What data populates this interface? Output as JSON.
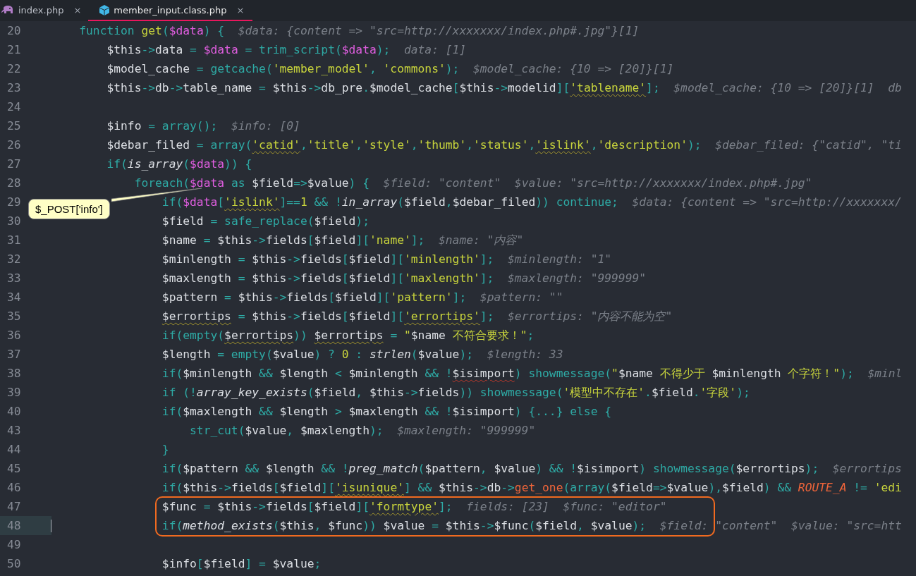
{
  "tabs": [
    {
      "label": "index.php",
      "selected": false,
      "close": "×"
    },
    {
      "label": "member_input.class.php",
      "selected": true,
      "close": "×"
    }
  ],
  "callout": {
    "text": "$_POST['info']"
  },
  "lines": [
    {
      "number": "20",
      "current": false,
      "boxed": false,
      "tokens": [
        {
          "kind": "k",
          "text": "    function "
        },
        {
          "kind": "s",
          "text": "get"
        },
        {
          "kind": "k",
          "text": "("
        },
        {
          "kind": "v",
          "text": "$data"
        },
        {
          "kind": "k",
          "text": ") {"
        }
      ],
      "hint": "$data: {content => \"src=http://xxxxxxx/index.php#.jpg\"}[1]"
    },
    {
      "number": "21",
      "current": false,
      "boxed": false,
      "tokens": [
        {
          "kind": "t",
          "text": "        $this"
        },
        {
          "kind": "k",
          "text": "->"
        },
        {
          "kind": "t",
          "text": "data "
        },
        {
          "kind": "k",
          "text": "= "
        },
        {
          "kind": "v",
          "text": "$data"
        },
        {
          "kind": "k",
          "text": " = trim_script("
        },
        {
          "kind": "v",
          "text": "$data"
        },
        {
          "kind": "k",
          "text": ");"
        }
      ],
      "hint": "data: [1]"
    },
    {
      "number": "22",
      "current": false,
      "boxed": false,
      "tokens": [
        {
          "kind": "t",
          "text": "        $model_cache "
        },
        {
          "kind": "k",
          "text": "= getcache("
        },
        {
          "kind": "s",
          "text": "'member_model'"
        },
        {
          "kind": "k",
          "text": ", "
        },
        {
          "kind": "s",
          "text": "'commons'"
        },
        {
          "kind": "k",
          "text": ");"
        }
      ],
      "hint": "$model_cache: {10 => [20]}[1]"
    },
    {
      "number": "23",
      "current": false,
      "boxed": false,
      "tokens": [
        {
          "kind": "t",
          "text": "        $this"
        },
        {
          "kind": "k",
          "text": "->"
        },
        {
          "kind": "t",
          "text": "db"
        },
        {
          "kind": "k",
          "text": "->"
        },
        {
          "kind": "t",
          "text": "table_name "
        },
        {
          "kind": "k",
          "text": "= "
        },
        {
          "kind": "t",
          "text": "$this"
        },
        {
          "kind": "k",
          "text": "->"
        },
        {
          "kind": "t",
          "text": "db_pre"
        },
        {
          "kind": "k",
          "text": "."
        },
        {
          "kind": "t",
          "text": "$model_cache"
        },
        {
          "kind": "k",
          "text": "["
        },
        {
          "kind": "t",
          "text": "$this"
        },
        {
          "kind": "k",
          "text": "->"
        },
        {
          "kind": "t",
          "text": "modelid"
        },
        {
          "kind": "k",
          "text": "]["
        },
        {
          "kind": "w",
          "text": "'tablename'"
        },
        {
          "kind": "k",
          "text": "];"
        }
      ],
      "hint": "$model_cache: {10 => [20]}[1]  db"
    },
    {
      "number": "24",
      "current": false,
      "boxed": false
    },
    {
      "number": "25",
      "current": false,
      "boxed": false,
      "tokens": [
        {
          "kind": "t",
          "text": "        $info "
        },
        {
          "kind": "k",
          "text": "= array();"
        }
      ],
      "hint": "$info: [0]"
    },
    {
      "number": "26",
      "current": false,
      "boxed": false,
      "tokens": [
        {
          "kind": "t",
          "text": "        $debar_filed "
        },
        {
          "kind": "k",
          "text": "= array("
        },
        {
          "kind": "w",
          "text": "'catid'"
        },
        {
          "kind": "k",
          "text": ","
        },
        {
          "kind": "s",
          "text": "'title'"
        },
        {
          "kind": "k",
          "text": ","
        },
        {
          "kind": "s",
          "text": "'style'"
        },
        {
          "kind": "k",
          "text": ","
        },
        {
          "kind": "s",
          "text": "'thumb'"
        },
        {
          "kind": "k",
          "text": ","
        },
        {
          "kind": "s",
          "text": "'status'"
        },
        {
          "kind": "k",
          "text": ","
        },
        {
          "kind": "w",
          "text": "'islink'"
        },
        {
          "kind": "k",
          "text": ","
        },
        {
          "kind": "s",
          "text": "'description'"
        },
        {
          "kind": "k",
          "text": ");"
        }
      ],
      "hint": "$debar_filed: {\"catid\", \"ti"
    },
    {
      "number": "27",
      "current": false,
      "boxed": false,
      "tokens": [
        {
          "kind": "k",
          "text": "        if("
        },
        {
          "kind": "i",
          "text": "is_array"
        },
        {
          "kind": "k",
          "text": "("
        },
        {
          "kind": "v",
          "text": "$data"
        },
        {
          "kind": "k",
          "text": ")) {"
        }
      ]
    },
    {
      "number": "28",
      "current": false,
      "boxed": false,
      "tokens": [
        {
          "kind": "k",
          "text": "            foreach("
        },
        {
          "kind": "v",
          "text": "$data"
        },
        {
          "kind": "k",
          "text": " as "
        },
        {
          "kind": "t",
          "text": "$field"
        },
        {
          "kind": "k",
          "text": "=>"
        },
        {
          "kind": "t",
          "text": "$value"
        },
        {
          "kind": "k",
          "text": ") {"
        }
      ],
      "hint": "$field: \"content\"  $value: \"src=http://xxxxxxx/index.php#.jpg\""
    },
    {
      "number": "29",
      "current": false,
      "boxed": false,
      "tokens": [
        {
          "kind": "k",
          "text": "                if("
        },
        {
          "kind": "v",
          "text": "$data"
        },
        {
          "kind": "k",
          "text": "["
        },
        {
          "kind": "w",
          "text": "'islink'"
        },
        {
          "kind": "k",
          "text": "]=="
        },
        {
          "kind": "n",
          "text": "1"
        },
        {
          "kind": "k",
          "text": " && !"
        },
        {
          "kind": "i",
          "text": "in_array"
        },
        {
          "kind": "k",
          "text": "("
        },
        {
          "kind": "t",
          "text": "$field"
        },
        {
          "kind": "k",
          "text": ","
        },
        {
          "kind": "t",
          "text": "$debar_filed"
        },
        {
          "kind": "k",
          "text": ")) continue;"
        }
      ],
      "hint": "$data: {content => \"src=http://xxxxxxx/"
    },
    {
      "number": "30",
      "current": false,
      "boxed": false,
      "tokens": [
        {
          "kind": "t",
          "text": "                $field "
        },
        {
          "kind": "k",
          "text": "= safe_replace("
        },
        {
          "kind": "t",
          "text": "$field"
        },
        {
          "kind": "k",
          "text": ");"
        }
      ]
    },
    {
      "number": "31",
      "current": false,
      "boxed": false,
      "tokens": [
        {
          "kind": "t",
          "text": "                $name "
        },
        {
          "kind": "k",
          "text": "= "
        },
        {
          "kind": "t",
          "text": "$this"
        },
        {
          "kind": "k",
          "text": "->"
        },
        {
          "kind": "t",
          "text": "fields"
        },
        {
          "kind": "k",
          "text": "["
        },
        {
          "kind": "t",
          "text": "$field"
        },
        {
          "kind": "k",
          "text": "]["
        },
        {
          "kind": "s",
          "text": "'name'"
        },
        {
          "kind": "k",
          "text": "];"
        }
      ],
      "hint": "$name: \"内容\""
    },
    {
      "number": "32",
      "current": false,
      "boxed": false,
      "tokens": [
        {
          "kind": "t",
          "text": "                $minlength "
        },
        {
          "kind": "k",
          "text": "= "
        },
        {
          "kind": "t",
          "text": "$this"
        },
        {
          "kind": "k",
          "text": "->"
        },
        {
          "kind": "t",
          "text": "fields"
        },
        {
          "kind": "k",
          "text": "["
        },
        {
          "kind": "t",
          "text": "$field"
        },
        {
          "kind": "k",
          "text": "]["
        },
        {
          "kind": "s",
          "text": "'minlength'"
        },
        {
          "kind": "k",
          "text": "];"
        }
      ],
      "hint": "$minlength: \"1\""
    },
    {
      "number": "33",
      "current": false,
      "boxed": false,
      "tokens": [
        {
          "kind": "t",
          "text": "                $maxlength "
        },
        {
          "kind": "k",
          "text": "= "
        },
        {
          "kind": "t",
          "text": "$this"
        },
        {
          "kind": "k",
          "text": "->"
        },
        {
          "kind": "t",
          "text": "fields"
        },
        {
          "kind": "k",
          "text": "["
        },
        {
          "kind": "t",
          "text": "$field"
        },
        {
          "kind": "k",
          "text": "]["
        },
        {
          "kind": "s",
          "text": "'maxlength'"
        },
        {
          "kind": "k",
          "text": "];"
        }
      ],
      "hint": "$maxlength: \"999999\""
    },
    {
      "number": "34",
      "current": false,
      "boxed": false,
      "tokens": [
        {
          "kind": "t",
          "text": "                $pattern "
        },
        {
          "kind": "k",
          "text": "= "
        },
        {
          "kind": "t",
          "text": "$this"
        },
        {
          "kind": "k",
          "text": "->"
        },
        {
          "kind": "t",
          "text": "fields"
        },
        {
          "kind": "k",
          "text": "["
        },
        {
          "kind": "t",
          "text": "$field"
        },
        {
          "kind": "k",
          "text": "]["
        },
        {
          "kind": "s",
          "text": "'pattern'"
        },
        {
          "kind": "k",
          "text": "];"
        }
      ],
      "hint": "$pattern: \"\""
    },
    {
      "number": "35",
      "current": false,
      "boxed": false,
      "tokens": [
        {
          "kind": "tw",
          "text": "                $errortips"
        },
        {
          "kind": "k",
          "text": " = "
        },
        {
          "kind": "t",
          "text": "$this"
        },
        {
          "kind": "k",
          "text": "->"
        },
        {
          "kind": "t",
          "text": "fields"
        },
        {
          "kind": "k",
          "text": "["
        },
        {
          "kind": "t",
          "text": "$field"
        },
        {
          "kind": "k",
          "text": "]["
        },
        {
          "kind": "w",
          "text": "'errortips'"
        },
        {
          "kind": "k",
          "text": "];"
        }
      ],
      "hint": "$errortips: \"内容不能为空\""
    },
    {
      "number": "36",
      "current": false,
      "boxed": false,
      "tokens": [
        {
          "kind": "k",
          "text": "                if(empty("
        },
        {
          "kind": "tw",
          "text": "$errortips"
        },
        {
          "kind": "k",
          "text": ")) "
        },
        {
          "kind": "tw",
          "text": "$errortips"
        },
        {
          "kind": "k",
          "text": " = "
        },
        {
          "kind": "s",
          "text": "\""
        },
        {
          "kind": "t",
          "text": "$name"
        },
        {
          "kind": "s",
          "text": " 不符合要求！\""
        },
        {
          "kind": "k",
          "text": ";"
        }
      ]
    },
    {
      "number": "37",
      "current": false,
      "boxed": false,
      "tokens": [
        {
          "kind": "t",
          "text": "                $length "
        },
        {
          "kind": "k",
          "text": "= empty("
        },
        {
          "kind": "t",
          "text": "$value"
        },
        {
          "kind": "k",
          "text": ") ? "
        },
        {
          "kind": "n",
          "text": "0"
        },
        {
          "kind": "k",
          "text": " : "
        },
        {
          "kind": "i",
          "text": "strlen"
        },
        {
          "kind": "k",
          "text": "("
        },
        {
          "kind": "t",
          "text": "$value"
        },
        {
          "kind": "k",
          "text": ");"
        }
      ],
      "hint": "$length: 33"
    },
    {
      "number": "38",
      "current": false,
      "boxed": false,
      "tokens": [
        {
          "kind": "k",
          "text": "                if("
        },
        {
          "kind": "t",
          "text": "$minlength "
        },
        {
          "kind": "k",
          "text": "&& "
        },
        {
          "kind": "t",
          "text": "$length "
        },
        {
          "kind": "k",
          "text": "< "
        },
        {
          "kind": "t",
          "text": "$minlength "
        },
        {
          "kind": "k",
          "text": "&& !"
        },
        {
          "kind": "te",
          "text": "$isimport"
        },
        {
          "kind": "k",
          "text": ") showmessage("
        },
        {
          "kind": "s",
          "text": "\""
        },
        {
          "kind": "t",
          "text": "$name"
        },
        {
          "kind": "s",
          "text": " 不得少于 "
        },
        {
          "kind": "t",
          "text": "$minlength"
        },
        {
          "kind": "s",
          "text": " 个字符！\""
        },
        {
          "kind": "k",
          "text": ");"
        }
      ],
      "hint": "$minl"
    },
    {
      "number": "39",
      "current": false,
      "boxed": false,
      "tokens": [
        {
          "kind": "k",
          "text": "                if (!"
        },
        {
          "kind": "i",
          "text": "array_key_exists"
        },
        {
          "kind": "k",
          "text": "("
        },
        {
          "kind": "t",
          "text": "$field"
        },
        {
          "kind": "k",
          "text": ", "
        },
        {
          "kind": "t",
          "text": "$this"
        },
        {
          "kind": "k",
          "text": "->"
        },
        {
          "kind": "t",
          "text": "fields"
        },
        {
          "kind": "k",
          "text": ")) showmessage("
        },
        {
          "kind": "s",
          "text": "'模型中不存在'"
        },
        {
          "kind": "k",
          "text": "."
        },
        {
          "kind": "t",
          "text": "$field"
        },
        {
          "kind": "k",
          "text": "."
        },
        {
          "kind": "s",
          "text": "'字段'"
        },
        {
          "kind": "k",
          "text": ");"
        }
      ]
    },
    {
      "number": "40",
      "current": false,
      "boxed": false,
      "tokens": [
        {
          "kind": "k",
          "text": "                if("
        },
        {
          "kind": "t",
          "text": "$maxlength "
        },
        {
          "kind": "k",
          "text": "&& "
        },
        {
          "kind": "t",
          "text": "$length "
        },
        {
          "kind": "k",
          "text": "> "
        },
        {
          "kind": "t",
          "text": "$maxlength "
        },
        {
          "kind": "k",
          "text": "&& !"
        },
        {
          "kind": "t",
          "text": "$isimport"
        },
        {
          "kind": "k",
          "text": ") {...} else {"
        }
      ]
    },
    {
      "number": "43",
      "current": false,
      "boxed": false,
      "tokens": [
        {
          "kind": "k",
          "text": "                    str_cut("
        },
        {
          "kind": "t",
          "text": "$value"
        },
        {
          "kind": "k",
          "text": ", "
        },
        {
          "kind": "t",
          "text": "$maxlength"
        },
        {
          "kind": "k",
          "text": ");"
        }
      ],
      "hint": "$maxlength: \"999999\""
    },
    {
      "number": "44",
      "current": false,
      "boxed": false,
      "tokens": [
        {
          "kind": "k",
          "text": "                }"
        }
      ]
    },
    {
      "number": "45",
      "current": false,
      "boxed": false,
      "tokens": [
        {
          "kind": "k",
          "text": "                if("
        },
        {
          "kind": "t",
          "text": "$pattern "
        },
        {
          "kind": "k",
          "text": "&& "
        },
        {
          "kind": "t",
          "text": "$length "
        },
        {
          "kind": "k",
          "text": "&& !"
        },
        {
          "kind": "i",
          "text": "preg_match"
        },
        {
          "kind": "k",
          "text": "("
        },
        {
          "kind": "t",
          "text": "$pattern"
        },
        {
          "kind": "k",
          "text": ", "
        },
        {
          "kind": "t",
          "text": "$value"
        },
        {
          "kind": "k",
          "text": ") && !"
        },
        {
          "kind": "t",
          "text": "$isimport"
        },
        {
          "kind": "k",
          "text": ") showmessage("
        },
        {
          "kind": "t",
          "text": "$errortips"
        },
        {
          "kind": "k",
          "text": ");"
        }
      ],
      "hint": "$errortips"
    },
    {
      "number": "46",
      "current": false,
      "boxed": false,
      "tokens": [
        {
          "kind": "k",
          "text": "                if("
        },
        {
          "kind": "t",
          "text": "$this"
        },
        {
          "kind": "k",
          "text": "->"
        },
        {
          "kind": "t",
          "text": "fields"
        },
        {
          "kind": "k",
          "text": "["
        },
        {
          "kind": "t",
          "text": "$field"
        },
        {
          "kind": "k",
          "text": "]["
        },
        {
          "kind": "w",
          "text": "'isunique'"
        },
        {
          "kind": "k",
          "text": "] && "
        },
        {
          "kind": "t",
          "text": "$this"
        },
        {
          "kind": "k",
          "text": "->"
        },
        {
          "kind": "t",
          "text": "db"
        },
        {
          "kind": "k",
          "text": "->"
        },
        {
          "kind": "o",
          "text": "get_one"
        },
        {
          "kind": "k",
          "text": "(array("
        },
        {
          "kind": "t",
          "text": "$field"
        },
        {
          "kind": "k",
          "text": "=>"
        },
        {
          "kind": "t",
          "text": "$value"
        },
        {
          "kind": "k",
          "text": "),"
        },
        {
          "kind": "t",
          "text": "$field"
        },
        {
          "kind": "k",
          "text": ") && "
        },
        {
          "kind": "oi",
          "text": "ROUTE_A"
        },
        {
          "kind": "k",
          "text": " != "
        },
        {
          "kind": "s",
          "text": "'edi"
        }
      ]
    },
    {
      "number": "47",
      "current": false,
      "boxed": true,
      "tokens": [
        {
          "kind": "t",
          "text": "                $func "
        },
        {
          "kind": "k",
          "text": "= "
        },
        {
          "kind": "t",
          "text": "$this"
        },
        {
          "kind": "k",
          "text": "->"
        },
        {
          "kind": "t",
          "text": "fields"
        },
        {
          "kind": "k",
          "text": "["
        },
        {
          "kind": "t",
          "text": "$field"
        },
        {
          "kind": "k",
          "text": "]["
        },
        {
          "kind": "w",
          "text": "'formtype'"
        },
        {
          "kind": "k",
          "text": "];"
        }
      ],
      "hint": "fields: [23]  $func: \"editor\""
    },
    {
      "number": "48",
      "current": true,
      "boxed": true,
      "tokens": [
        {
          "kind": "k",
          "text": "                if("
        },
        {
          "kind": "i",
          "text": "method_exists"
        },
        {
          "kind": "k",
          "text": "("
        },
        {
          "kind": "t",
          "text": "$this"
        },
        {
          "kind": "k",
          "text": ", "
        },
        {
          "kind": "t",
          "text": "$func"
        },
        {
          "kind": "k",
          "text": ")) "
        },
        {
          "kind": "t",
          "text": "$value "
        },
        {
          "kind": "k",
          "text": "= "
        },
        {
          "kind": "t",
          "text": "$this"
        },
        {
          "kind": "k",
          "text": "->"
        },
        {
          "kind": "t",
          "text": "$func"
        },
        {
          "kind": "k",
          "text": "("
        },
        {
          "kind": "t",
          "text": "$field"
        },
        {
          "kind": "k",
          "text": ", "
        },
        {
          "kind": "t",
          "text": "$value"
        },
        {
          "kind": "k",
          "text": ");"
        }
      ],
      "hint": "$field: \"content\"  $value: \"src=htt"
    },
    {
      "number": "49",
      "current": false,
      "boxed": false
    },
    {
      "number": "50",
      "current": false,
      "boxed": false,
      "tokens": [
        {
          "kind": "t",
          "text": "                $info"
        },
        {
          "kind": "k",
          "text": "["
        },
        {
          "kind": "t",
          "text": "$field"
        },
        {
          "kind": "k",
          "text": "] = "
        },
        {
          "kind": "t",
          "text": "$value"
        },
        {
          "kind": "k",
          "text": ";"
        }
      ]
    }
  ]
}
